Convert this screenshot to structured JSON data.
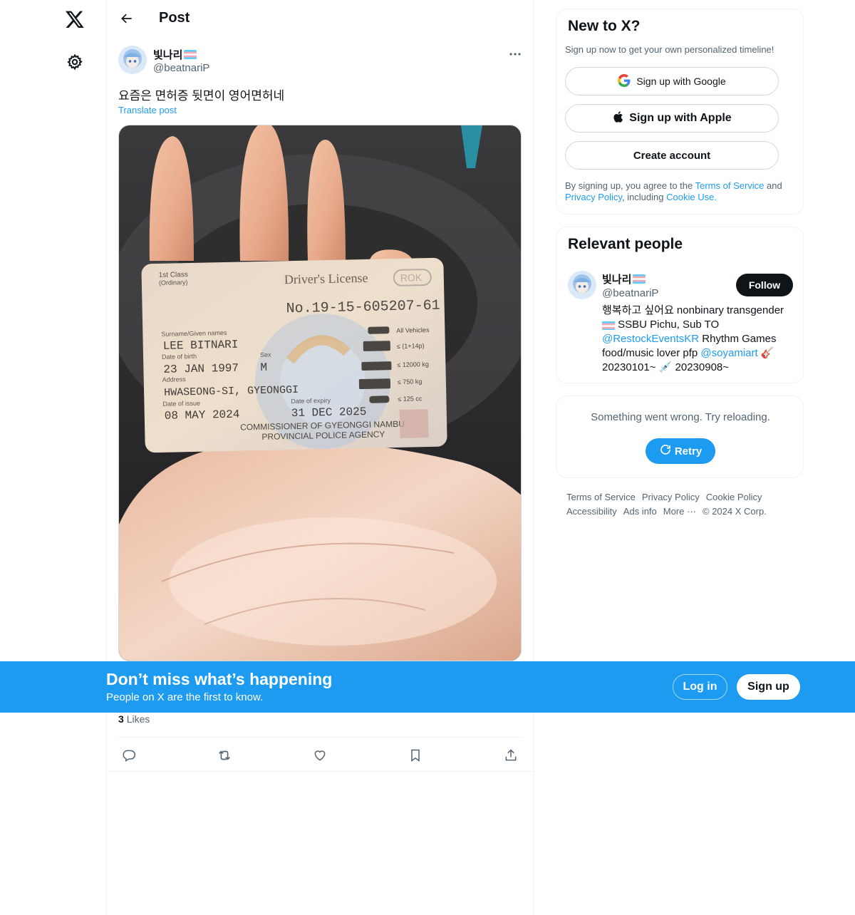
{
  "header": {
    "title": "Post"
  },
  "post": {
    "display_name": "빛나리",
    "handle": "@beatnariP",
    "text": "요즘은 면허증 뒷면이 영어면허네",
    "translate_label": "Translate post",
    "likes_count": "3",
    "likes_label": "Likes"
  },
  "license": {
    "class_line1": "1st Class",
    "class_line2": "(Ordinary)",
    "title": "Driver's License",
    "country": "ROK",
    "number": "No.19-15-605207-61",
    "surname_label": "Surname/Given names",
    "name": "LEE BITNARI",
    "dob_label": "Date of birth",
    "dob": "23 JAN 1997",
    "sex_label": "Sex",
    "sex": "M",
    "address_label": "Address",
    "address": "HWASEONG-SI, GYEONGGI",
    "issue_label": "Date of issue",
    "issue": "08 MAY 2024",
    "expiry_label": "Date of expiry",
    "expiry": "31 DEC 2025",
    "commissioner1": "COMMISSIONER OF GYEONGGI NAMBU",
    "commissioner2": "PROVINCIAL POLICE AGENCY",
    "vehicles": [
      "All Vehicles",
      "≤ (1+14p)",
      "≤ 12000 kg",
      "≤ 750 kg",
      "≤ 125 cc"
    ]
  },
  "signup_card": {
    "title": "New to X?",
    "subtitle": "Sign up now to get your own personalized timeline!",
    "google_label": "Sign up with Google",
    "apple_label": "Sign up with Apple",
    "create_label": "Create account",
    "terms_prefix": "By signing up, you agree to the ",
    "terms_link": "Terms of Service",
    "terms_and": " and ",
    "privacy_link": "Privacy Policy",
    "terms_including": ", including ",
    "cookie_link": "Cookie Use."
  },
  "relevant": {
    "title": "Relevant people",
    "name": "빛나리",
    "handle": "@beatnariP",
    "follow_label": "Follow",
    "bio_1": "행복하고 싶어요 nonbinary transgender",
    "bio_2": " SSBU Pichu, Sub TO ",
    "bio_link1": "@RestockEventsKR",
    "bio_3": " Rhythm Games food/music lover pfp ",
    "bio_link2": "@soyamiart",
    "bio_4": " 🎸 20230101~ 💉 20230908~"
  },
  "error_card": {
    "message": "Something went wrong. Try reloading.",
    "retry_label": "Retry"
  },
  "footer": {
    "links": [
      "Terms of Service",
      "Privacy Policy",
      "Cookie Policy",
      "Accessibility",
      "Ads info",
      "More ···",
      "© 2024 X Corp."
    ]
  },
  "banner": {
    "title": "Don’t miss what’s happening",
    "subtitle": "People on X are the first to know.",
    "login_label": "Log in",
    "signup_label": "Sign up"
  },
  "icons": {
    "logo": "x-logo-icon",
    "settings": "gear-icon",
    "back": "arrow-left-icon",
    "more": "more-dots-icon",
    "reply": "reply-icon",
    "repost": "repost-icon",
    "like": "heart-icon",
    "bookmark": "bookmark-icon",
    "share": "share-icon"
  },
  "colors": {
    "accent": "#1d9bf0",
    "text": "#0f1419",
    "muted": "#536471"
  }
}
